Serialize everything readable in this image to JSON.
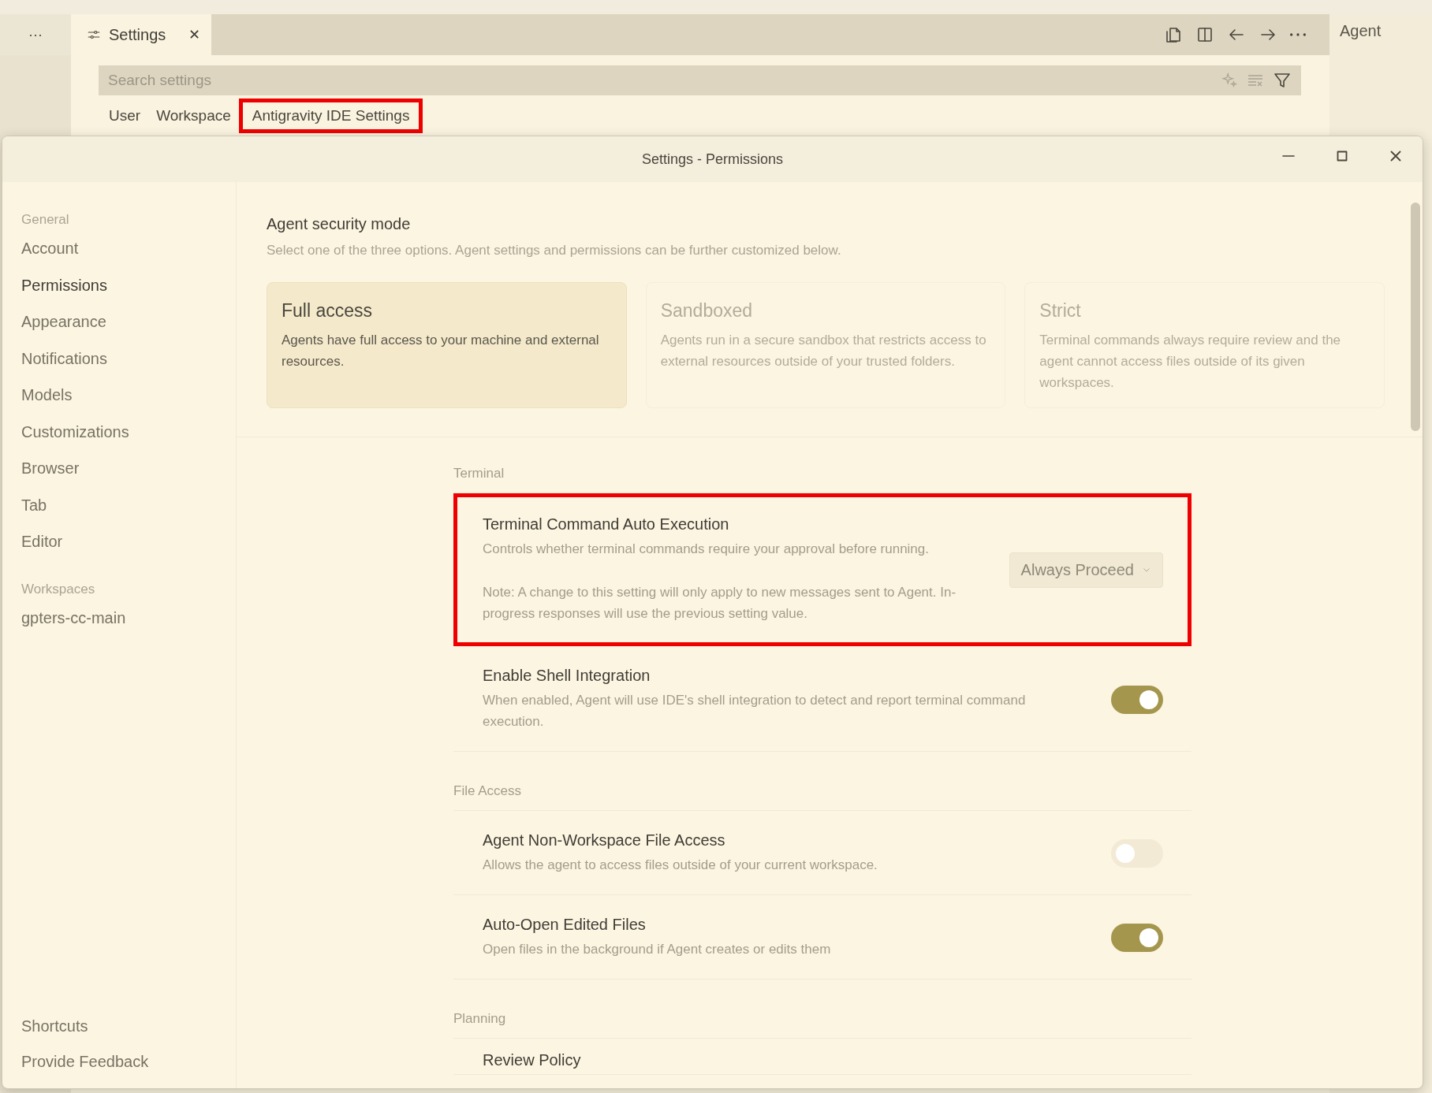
{
  "editor": {
    "more_menu": "···",
    "tab": {
      "label": "Settings",
      "close": "✕"
    },
    "side_panel": "Agent"
  },
  "search": {
    "placeholder": "Search settings"
  },
  "scopes": [
    {
      "label": "User",
      "highlighted": false
    },
    {
      "label": "Workspace",
      "highlighted": false
    },
    {
      "label": "Antigravity IDE Settings",
      "highlighted": true
    }
  ],
  "dialog": {
    "title": "Settings - Permissions",
    "sidebar": {
      "sections": [
        {
          "heading": "General",
          "items": [
            {
              "label": "Account",
              "selected": false
            },
            {
              "label": "Permissions",
              "selected": true
            },
            {
              "label": "Appearance",
              "selected": false
            },
            {
              "label": "Notifications",
              "selected": false
            },
            {
              "label": "Models",
              "selected": false
            },
            {
              "label": "Customizations",
              "selected": false
            },
            {
              "label": "Browser",
              "selected": false
            },
            {
              "label": "Tab",
              "selected": false
            },
            {
              "label": "Editor",
              "selected": false
            }
          ]
        },
        {
          "heading": "Workspaces",
          "items": [
            {
              "label": "gpters-cc-main",
              "selected": false
            }
          ]
        }
      ],
      "footer": [
        "Shortcuts",
        "Provide Feedback"
      ]
    },
    "security_mode": {
      "title": "Agent security mode",
      "description": "Select one of the three options. Agent settings and permissions can be further customized below.",
      "options": [
        {
          "title": "Full access",
          "description": "Agents have full access to your machine and external resources.",
          "selected": true
        },
        {
          "title": "Sandboxed",
          "description": "Agents run in a secure sandbox that restricts access to external resources outside of your trusted folders.",
          "selected": false
        },
        {
          "title": "Strict",
          "description": "Terminal commands always require review and the agent cannot access files outside of its given workspaces.",
          "selected": false
        }
      ]
    },
    "groups": [
      {
        "heading": "Terminal",
        "settings": [
          {
            "kind": "dropdown",
            "title": "Terminal Command Auto Execution",
            "description": "Controls whether terminal commands require your approval before running.",
            "note": "Note: A change to this setting will only apply to new messages sent to Agent. In-progress responses will use the previous setting value.",
            "value": "Always Proceed",
            "highlighted": true
          },
          {
            "kind": "toggle",
            "title": "Enable Shell Integration",
            "description": "When enabled, Agent will use IDE's shell integration to detect and report terminal command execution.",
            "on": true,
            "highlighted": false
          }
        ]
      },
      {
        "heading": "File Access",
        "settings": [
          {
            "kind": "toggle",
            "title": "Agent Non-Workspace File Access",
            "description": "Allows the agent to access files outside of your current workspace.",
            "on": false,
            "highlighted": false
          },
          {
            "kind": "toggle",
            "title": "Auto-Open Edited Files",
            "description": "Open files in the background if Agent creates or edits them",
            "on": true,
            "highlighted": false
          }
        ]
      },
      {
        "heading": "Planning",
        "settings": [
          {
            "kind": "title_only",
            "title": "Review Policy",
            "highlighted": false
          }
        ]
      }
    ]
  }
}
